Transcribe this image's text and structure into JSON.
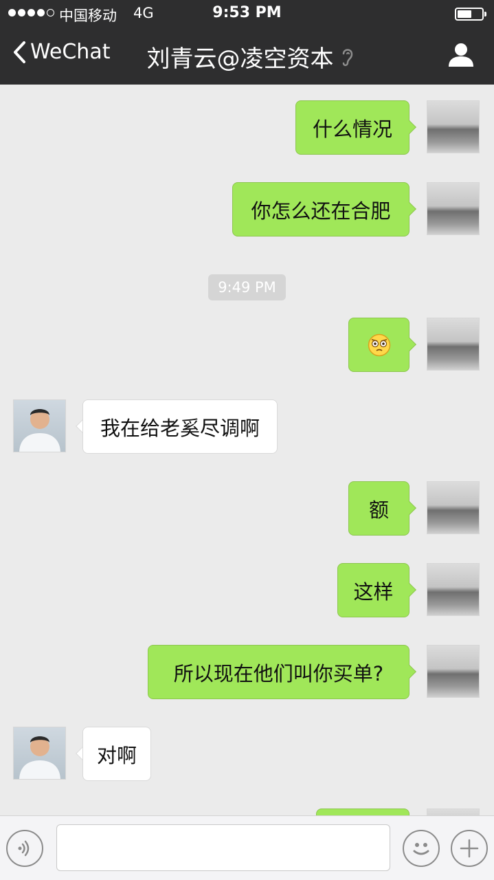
{
  "status_bar": {
    "carrier": "中国移动",
    "network": "4G",
    "time": "9:53 PM",
    "signal_bars": 4,
    "signal_max": 5,
    "battery_level": 0.55
  },
  "nav": {
    "back_label": "WeChat",
    "title": "刘青云@凌空资本",
    "icons": {
      "back": "chevron-left-icon",
      "earpiece": "ear-icon",
      "profile": "person-icon"
    }
  },
  "colors": {
    "header_bg": "#2e2e2f",
    "chat_bg": "#ebebeb",
    "my_bubble": "#a0e759",
    "other_bubble": "#ffffff"
  },
  "messages": [
    {
      "sender": "me",
      "text": "什么情况"
    },
    {
      "sender": "me",
      "text": "你怎么还在合肥"
    },
    {
      "timestamp": "9:49 PM"
    },
    {
      "sender": "me",
      "emoji": "annoyed-face-emoji"
    },
    {
      "sender": "other",
      "text": "我在给老奚尽调啊"
    },
    {
      "sender": "me",
      "text": "额"
    },
    {
      "sender": "me",
      "text": "这样"
    },
    {
      "sender": "me",
      "text": "所以现在他们叫你买单?"
    },
    {
      "sender": "other",
      "text": "对啊"
    },
    {
      "sender": "me",
      "text": ""
    }
  ],
  "input_bar": {
    "voice_icon": "voice-icon",
    "text_value": "",
    "emoji_icon": "smiley-icon",
    "plus_icon": "plus-icon"
  }
}
